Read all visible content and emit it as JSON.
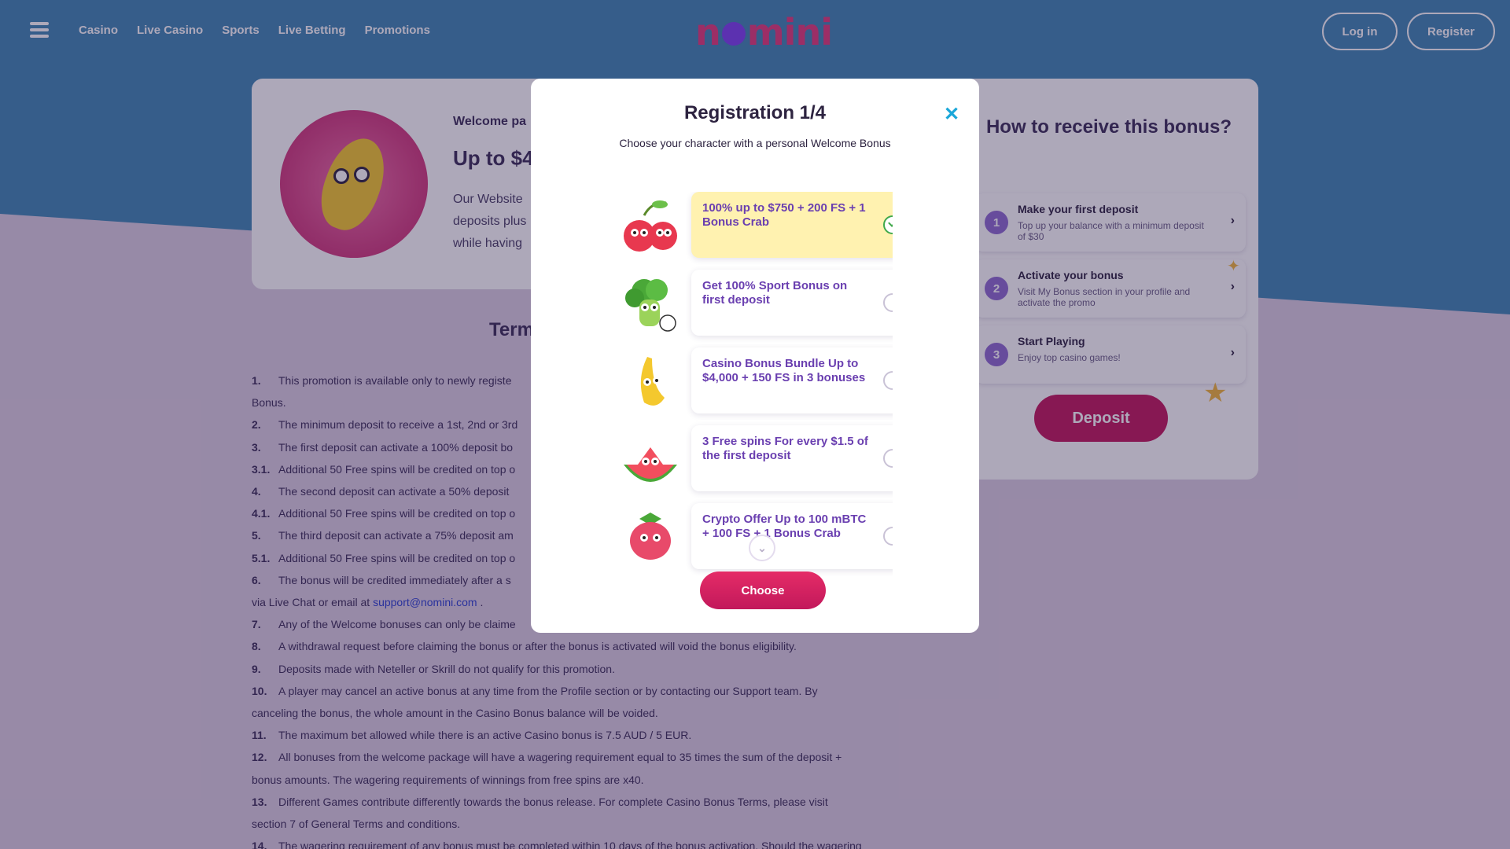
{
  "header": {
    "nav": [
      "Casino",
      "Live Casino",
      "Sports",
      "Live Betting",
      "Promotions"
    ],
    "logo_parts": [
      "n",
      "mini"
    ],
    "login_label": "Log in",
    "register_label": "Register"
  },
  "promo": {
    "kicker": "Welcome pa",
    "headline": "Up to $4",
    "desc_lines": [
      "Our Website",
      "deposits plus",
      "while having"
    ]
  },
  "how_to": {
    "title": "How to receive this bonus?",
    "steps": [
      {
        "num": "1",
        "title": "Make your first deposit",
        "sub": "Top up your balance with a minimum deposit of $30"
      },
      {
        "num": "2",
        "title": "Activate your bonus",
        "sub": "Visit My Bonus section in your profile and activate the promo"
      },
      {
        "num": "3",
        "title": "Start Playing",
        "sub": "Enjoy top casino games!"
      }
    ],
    "deposit_label": "Deposit"
  },
  "terms": {
    "title": "Term",
    "rows": [
      {
        "num": "1.",
        "text": "This promotion is available only to newly registe"
      },
      {
        "num": "",
        "text": "Bonus."
      },
      {
        "num": "2.",
        "text": "The minimum deposit to receive a 1st, 2nd or 3rd"
      },
      {
        "num": "3.",
        "text": "The first deposit can activate a 100% deposit bo"
      },
      {
        "num": "3.1.",
        "text": "Additional 50 Free spins will be credited on top o"
      },
      {
        "num": "4.",
        "text": "The second deposit can activate a 50% deposit"
      },
      {
        "num": "4.1.",
        "text": "Additional 50 Free spins will be credited on top o"
      },
      {
        "num": "5.",
        "text": "The third deposit can activate a 75% deposit am"
      },
      {
        "num": "5.1.",
        "text": "Additional 50 Free spins will be credited on top o"
      },
      {
        "num": "6.",
        "text": "The bonus will be credited immediately after a s"
      },
      {
        "num": "",
        "text": "via Live Chat or email at ",
        "link": "support@nomini.com",
        "after": " ."
      },
      {
        "num": "7.",
        "text": "Any of the Welcome bonuses can only be claime"
      },
      {
        "num": "8.",
        "text": "A withdrawal request before claiming the bonus or after the bonus is activated will void the bonus eligibility."
      },
      {
        "num": "9.",
        "text": "Deposits made with Neteller or Skrill do not qualify for this promotion."
      },
      {
        "num": "10.",
        "text": "A player may cancel an active bonus at any time from the Profile section or by contacting our Support team. By"
      },
      {
        "num": "",
        "text": "canceling the bonus, the whole amount in the Casino Bonus balance will be voided."
      },
      {
        "num": "11.",
        "text": "The maximum bet allowed while there is an active Casino bonus is 7.5 AUD / 5 EUR."
      },
      {
        "num": "12.",
        "text": "All bonuses from the welcome package will have a wagering requirement equal to 35 times the sum of the deposit +"
      },
      {
        "num": "",
        "text": "bonus amounts. The wagering requirements of winnings from free spins are x40."
      },
      {
        "num": "13.",
        "text": "Different Games contribute differently towards the bonus release. For complete Casino Bonus Terms, please visit"
      },
      {
        "num": "",
        "text": "section 7 of General Terms and conditions."
      },
      {
        "num": "14.",
        "text": "The wagering requirement of any bonus must be completed within 10 days of the bonus activation. Should the wagering"
      }
    ]
  },
  "modal": {
    "title": "Registration 1/4",
    "subtitle": "Choose your character with a personal Welcome Bonus",
    "options": [
      {
        "label": "100% up to $750 + 200 FS + 1 Bonus Crab",
        "selected": true,
        "mascot": "cherry-mascot"
      },
      {
        "label": "Get 100% Sport Bonus on first deposit",
        "selected": false,
        "mascot": "broccoli-mascot"
      },
      {
        "label": "Casino Bonus Bundle Up to $4,000 + 150 FS in 3 bonuses",
        "selected": false,
        "mascot": "banana-mascot"
      },
      {
        "label": "3 Free spins For every $1.5 of the first deposit",
        "selected": false,
        "mascot": "watermelon-mascot"
      },
      {
        "label": "Crypto Offer Up to 100 mBTC + 100 FS + 1 Bonus Crab",
        "selected": false,
        "mascot": "strawberry-mascot"
      }
    ],
    "choose_label": "Choose",
    "close_glyph": "✕",
    "scroll_glyph": "⌄"
  },
  "colors": {
    "brand_pink": "#c2185b",
    "accent_purple": "#6a3fb0",
    "selected_bg": "#fff2b0",
    "close_blue": "#1aa7d9"
  }
}
